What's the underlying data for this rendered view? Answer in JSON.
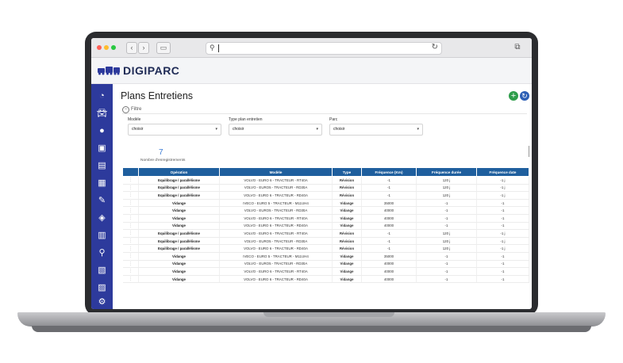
{
  "app": {
    "brand": "DIGIPARC"
  },
  "page": {
    "title": "Plans Entretiens"
  },
  "filter": {
    "toggle_label": "Filtre",
    "fields": [
      {
        "label": "Modèle",
        "value": "choisir"
      },
      {
        "label": "Type plan entretien",
        "value": "choisir"
      },
      {
        "label": "Parc",
        "value": "choisir"
      }
    ]
  },
  "records": {
    "count": "7",
    "label": "Nombre d'enregistrements"
  },
  "table": {
    "columns": [
      "Opération",
      "Modèle",
      "Type",
      "Fréquence (Km)",
      "Fréquence durée",
      "Fréquence date"
    ],
    "rows": [
      {
        "op": "Equilibrage / parallélisme",
        "model": "VOLVO - EURO 6 - TRACTEUR - RT40A",
        "type": "Révision",
        "km": "-1",
        "dur": "120 j",
        "date": "-1 j"
      },
      {
        "op": "Equilibrage / parallélisme",
        "model": "VOLVO - EURO5 - TRACTEUR - RD30A",
        "type": "Révision",
        "km": "-1",
        "dur": "120 j",
        "date": "-1 j"
      },
      {
        "op": "Equilibrage / parallélisme",
        "model": "VOLVO - EURO 6 - TRACTEUR - RD40A",
        "type": "Révision",
        "km": "-1",
        "dur": "120 j",
        "date": "-1 j"
      },
      {
        "op": "Vidange",
        "model": "IVECO - EURO 5 - TRACTEUR - M11UH4",
        "type": "Vidange",
        "km": "35000",
        "dur": "-1",
        "date": "-1"
      },
      {
        "op": "Vidange",
        "model": "VOLVO - EURO5 - TRACTEUR - RD30A",
        "type": "Vidange",
        "km": "40000",
        "dur": "-1",
        "date": "-1"
      },
      {
        "op": "Vidange",
        "model": "VOLVO - EURO 6 - TRACTEUR - RT40A",
        "type": "Vidange",
        "km": "40000",
        "dur": "-1",
        "date": "-1"
      },
      {
        "op": "Vidange",
        "model": "VOLVO - EURO 6 - TRACTEUR - RD40A",
        "type": "Vidange",
        "km": "40000",
        "dur": "-1",
        "date": "-1"
      },
      {
        "op": "Equilibrage / parallélisme",
        "model": "VOLVO - EURO 6 - TRACTEUR - RT40A",
        "type": "Révision",
        "km": "-1",
        "dur": "120 j",
        "date": "-1 j"
      },
      {
        "op": "Equilibrage / parallélisme",
        "model": "VOLVO - EURO5 - TRACTEUR - RD30A",
        "type": "Révision",
        "km": "-1",
        "dur": "120 j",
        "date": "-1 j"
      },
      {
        "op": "Equilibrage / parallélisme",
        "model": "VOLVO - EURO 6 - TRACTEUR - RD40A",
        "type": "Révision",
        "km": "-1",
        "dur": "120 j",
        "date": "-1 j"
      },
      {
        "op": "Vidange",
        "model": "IVECO - EURO 5 - TRACTEUR - M11UH4",
        "type": "Vidange",
        "km": "35000",
        "dur": "-1",
        "date": "-1"
      },
      {
        "op": "Vidange",
        "model": "VOLVO - EURO5 - TRACTEUR - RD30A",
        "type": "Vidange",
        "km": "40000",
        "dur": "-1",
        "date": "-1"
      },
      {
        "op": "Vidange",
        "model": "VOLVO - EURO 6 - TRACTEUR - RT40A",
        "type": "Vidange",
        "km": "40000",
        "dur": "-1",
        "date": "-1"
      },
      {
        "op": "Vidange",
        "model": "VOLVO - EURO 6 - TRACTEUR - RD40A",
        "type": "Vidange",
        "km": "40000",
        "dur": "-1",
        "date": "-1"
      }
    ]
  },
  "sidebar": {
    "icons": [
      "dashboard-icon",
      "car-icon",
      "user-icon",
      "truck-icon",
      "document-icon",
      "fuel-icon",
      "wrench-icon",
      "layers-icon",
      "building-icon",
      "map-pin-icon",
      "garage-icon",
      "notes-icon",
      "settings-icon"
    ]
  },
  "colors": {
    "sidebar": "#2d3a9c",
    "table_header": "#1f5f9e",
    "revision": "#2b43c4",
    "vidange": "#2e8a2e",
    "add_button": "#2e9d4b",
    "refresh_button": "#2d5fb5"
  }
}
